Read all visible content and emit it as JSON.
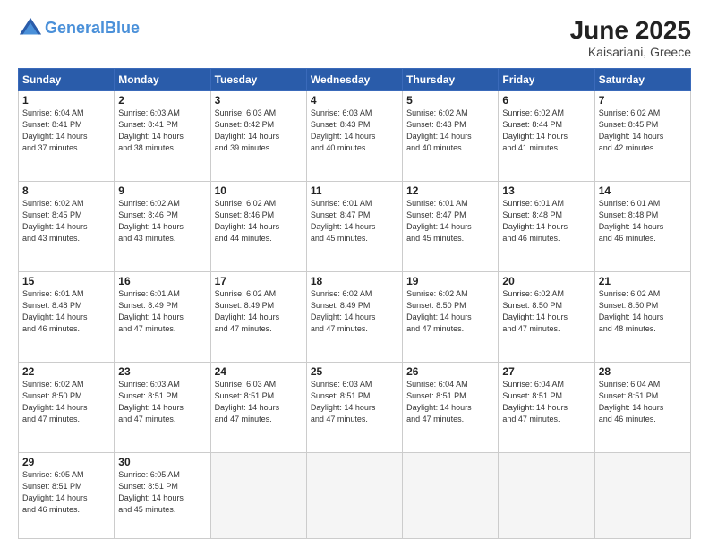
{
  "header": {
    "logo_line1": "General",
    "logo_line2": "Blue",
    "month": "June 2025",
    "location": "Kaisariani, Greece"
  },
  "weekdays": [
    "Sunday",
    "Monday",
    "Tuesday",
    "Wednesday",
    "Thursday",
    "Friday",
    "Saturday"
  ],
  "weeks": [
    [
      {
        "day": "1",
        "info": "Sunrise: 6:04 AM\nSunset: 8:41 PM\nDaylight: 14 hours\nand 37 minutes."
      },
      {
        "day": "2",
        "info": "Sunrise: 6:03 AM\nSunset: 8:41 PM\nDaylight: 14 hours\nand 38 minutes."
      },
      {
        "day": "3",
        "info": "Sunrise: 6:03 AM\nSunset: 8:42 PM\nDaylight: 14 hours\nand 39 minutes."
      },
      {
        "day": "4",
        "info": "Sunrise: 6:03 AM\nSunset: 8:43 PM\nDaylight: 14 hours\nand 40 minutes."
      },
      {
        "day": "5",
        "info": "Sunrise: 6:02 AM\nSunset: 8:43 PM\nDaylight: 14 hours\nand 40 minutes."
      },
      {
        "day": "6",
        "info": "Sunrise: 6:02 AM\nSunset: 8:44 PM\nDaylight: 14 hours\nand 41 minutes."
      },
      {
        "day": "7",
        "info": "Sunrise: 6:02 AM\nSunset: 8:45 PM\nDaylight: 14 hours\nand 42 minutes."
      }
    ],
    [
      {
        "day": "8",
        "info": "Sunrise: 6:02 AM\nSunset: 8:45 PM\nDaylight: 14 hours\nand 43 minutes."
      },
      {
        "day": "9",
        "info": "Sunrise: 6:02 AM\nSunset: 8:46 PM\nDaylight: 14 hours\nand 43 minutes."
      },
      {
        "day": "10",
        "info": "Sunrise: 6:02 AM\nSunset: 8:46 PM\nDaylight: 14 hours\nand 44 minutes."
      },
      {
        "day": "11",
        "info": "Sunrise: 6:01 AM\nSunset: 8:47 PM\nDaylight: 14 hours\nand 45 minutes."
      },
      {
        "day": "12",
        "info": "Sunrise: 6:01 AM\nSunset: 8:47 PM\nDaylight: 14 hours\nand 45 minutes."
      },
      {
        "day": "13",
        "info": "Sunrise: 6:01 AM\nSunset: 8:48 PM\nDaylight: 14 hours\nand 46 minutes."
      },
      {
        "day": "14",
        "info": "Sunrise: 6:01 AM\nSunset: 8:48 PM\nDaylight: 14 hours\nand 46 minutes."
      }
    ],
    [
      {
        "day": "15",
        "info": "Sunrise: 6:01 AM\nSunset: 8:48 PM\nDaylight: 14 hours\nand 46 minutes."
      },
      {
        "day": "16",
        "info": "Sunrise: 6:01 AM\nSunset: 8:49 PM\nDaylight: 14 hours\nand 47 minutes."
      },
      {
        "day": "17",
        "info": "Sunrise: 6:02 AM\nSunset: 8:49 PM\nDaylight: 14 hours\nand 47 minutes."
      },
      {
        "day": "18",
        "info": "Sunrise: 6:02 AM\nSunset: 8:49 PM\nDaylight: 14 hours\nand 47 minutes."
      },
      {
        "day": "19",
        "info": "Sunrise: 6:02 AM\nSunset: 8:50 PM\nDaylight: 14 hours\nand 47 minutes."
      },
      {
        "day": "20",
        "info": "Sunrise: 6:02 AM\nSunset: 8:50 PM\nDaylight: 14 hours\nand 47 minutes."
      },
      {
        "day": "21",
        "info": "Sunrise: 6:02 AM\nSunset: 8:50 PM\nDaylight: 14 hours\nand 48 minutes."
      }
    ],
    [
      {
        "day": "22",
        "info": "Sunrise: 6:02 AM\nSunset: 8:50 PM\nDaylight: 14 hours\nand 47 minutes."
      },
      {
        "day": "23",
        "info": "Sunrise: 6:03 AM\nSunset: 8:51 PM\nDaylight: 14 hours\nand 47 minutes."
      },
      {
        "day": "24",
        "info": "Sunrise: 6:03 AM\nSunset: 8:51 PM\nDaylight: 14 hours\nand 47 minutes."
      },
      {
        "day": "25",
        "info": "Sunrise: 6:03 AM\nSunset: 8:51 PM\nDaylight: 14 hours\nand 47 minutes."
      },
      {
        "day": "26",
        "info": "Sunrise: 6:04 AM\nSunset: 8:51 PM\nDaylight: 14 hours\nand 47 minutes."
      },
      {
        "day": "27",
        "info": "Sunrise: 6:04 AM\nSunset: 8:51 PM\nDaylight: 14 hours\nand 47 minutes."
      },
      {
        "day": "28",
        "info": "Sunrise: 6:04 AM\nSunset: 8:51 PM\nDaylight: 14 hours\nand 46 minutes."
      }
    ],
    [
      {
        "day": "29",
        "info": "Sunrise: 6:05 AM\nSunset: 8:51 PM\nDaylight: 14 hours\nand 46 minutes."
      },
      {
        "day": "30",
        "info": "Sunrise: 6:05 AM\nSunset: 8:51 PM\nDaylight: 14 hours\nand 45 minutes."
      },
      {
        "day": "",
        "info": ""
      },
      {
        "day": "",
        "info": ""
      },
      {
        "day": "",
        "info": ""
      },
      {
        "day": "",
        "info": ""
      },
      {
        "day": "",
        "info": ""
      }
    ]
  ]
}
